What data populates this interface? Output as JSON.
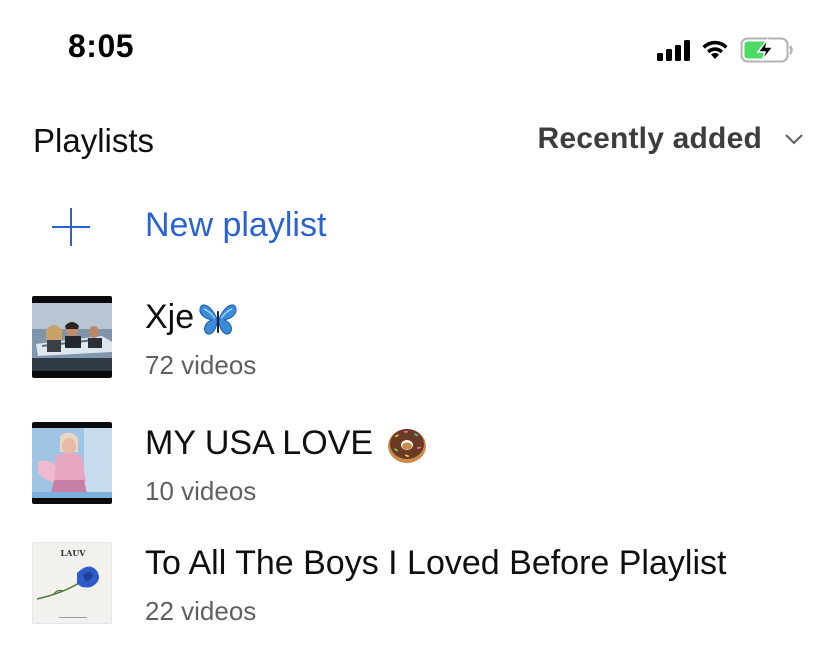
{
  "status_bar": {
    "time": "8:05",
    "icons": [
      "cellular-signal-icon",
      "wifi-icon",
      "battery-charging-icon"
    ],
    "battery_color": "#4cd964"
  },
  "header": {
    "title": "Playlists",
    "sort": {
      "selected": "Recently added",
      "icon": "chevron-down-icon"
    }
  },
  "new_playlist": {
    "icon": "plus-icon",
    "label": "New playlist",
    "color": "#2a63d1"
  },
  "playlists": [
    {
      "title": "Xje",
      "emoji": "butterfly",
      "count": "72 videos",
      "thumbnail": "car-scene-thumbnail"
    },
    {
      "title": "MY USA LOVE ",
      "emoji": "doughnut",
      "count": "10 videos",
      "thumbnail": "pink-figure-thumbnail"
    },
    {
      "title": "To All The Boys I Loved Before Playlist",
      "count": "22 videos",
      "thumbnail": "album-art-blue-rose-thumbnail",
      "thumbnail_text": "LAUV"
    }
  ]
}
